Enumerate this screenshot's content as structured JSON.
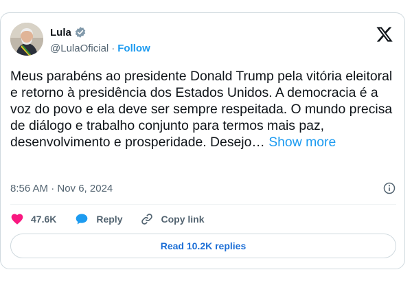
{
  "author": {
    "display_name": "Lula",
    "handle": "@LulaOficial",
    "separator": "·",
    "follow_label": "Follow",
    "verified_icon": "verified-badge-icon",
    "avatar_icon": "profile-avatar"
  },
  "brand_icon": "x-logo-icon",
  "tweet": {
    "text": "Meus parabéns ao presidente Donald Trump pela vitória eleitoral e retorno à presidência dos Estados Unidos. A democracia é a voz do povo e ela deve ser sempre respeitada. O mundo precisa de diálogo e trabalho conjunto para termos mais paz, desenvolvimento e prosperidade. Desejo…",
    "show_more_label": "Show more",
    "timestamp": "8:56 AM · Nov 6, 2024",
    "info_icon": "info-icon"
  },
  "actions": {
    "likes_count": "47.6K",
    "like_icon": "heart-icon",
    "reply_label": "Reply",
    "reply_icon": "speech-bubble-icon",
    "copy_link_label": "Copy link",
    "copy_link_icon": "link-icon"
  },
  "replies_button": {
    "label": "Read 10.2K replies"
  },
  "colors": {
    "accent": "#1d9bf0",
    "replies_text": "#1d6fd6",
    "heart": "#f91880",
    "verified": "#829aab",
    "muted_text": "#536471",
    "border": "#cfd9de"
  }
}
